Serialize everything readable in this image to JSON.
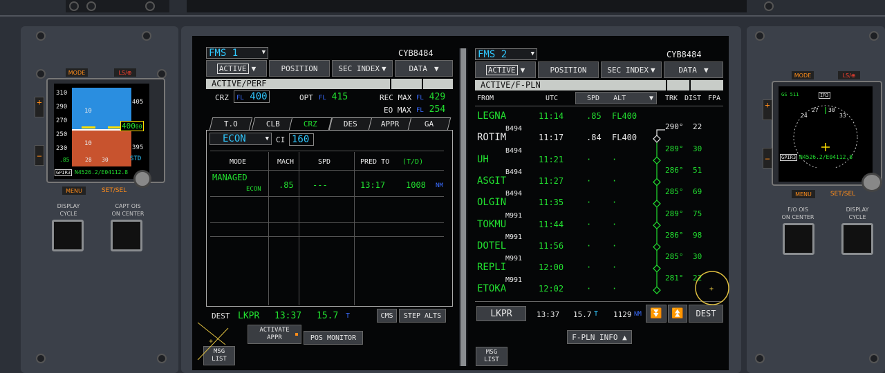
{
  "left_panel": {
    "mode_label": "MODE",
    "ls_label": "LS/⊕",
    "menu_label": "MENU",
    "setsel_label": "SET/SEL",
    "display_cycle_label": "DISPLAY\nCYCLE",
    "capt_ois_label": "CAPT OIS\nON CENTER",
    "speed_ticks": [
      "310",
      "290",
      "270",
      "250",
      "230"
    ],
    "alt_ticks": [
      "405",
      "400",
      "395"
    ],
    "alt_readout": "400",
    "alt_sub": "00",
    "mach": ".85",
    "std": "STD",
    "gpirs": "GPIR3",
    "pos": "N4526.2/E04112.8",
    "pitch_top": "10",
    "pitch_bot": "10",
    "roll_marks": [
      "28",
      "30"
    ]
  },
  "right_panel": {
    "mode_label": "MODE",
    "ls_label": "LS/⊕",
    "menu_label": "MENU",
    "setsel_label": "SET/SEL",
    "fo_ois_label": "F/O OIS\nON CENTER",
    "display_cycle_label": "DISPLAY\nCYCLE",
    "gs": "GS 511",
    "ir": "IR3",
    "gpirs": "GPIR3",
    "pos": "N4526.2/E04112.8",
    "heading_marks": [
      "24",
      "27",
      "30",
      "33"
    ]
  },
  "fms1": {
    "title": "FMS 1",
    "flight_id": "CYB8484",
    "nav": [
      "ACTIVE",
      "POSITION",
      "SEC INDEX",
      "DATA"
    ],
    "page_title": "ACTIVE/PERF",
    "crz_label": "CRZ",
    "crz_fl": "FL",
    "crz_val": "400",
    "opt_label": "OPT",
    "opt_fl": "FL",
    "opt_val": "415",
    "recmax_label": "REC MAX",
    "recmax_fl": "FL",
    "recmax_val": "429",
    "eomax_label": "EO MAX",
    "eomax_fl": "FL",
    "eomax_val": "254",
    "tabs": [
      "T.O",
      "CLB",
      "CRZ",
      "DES",
      "APPR",
      "GA"
    ],
    "mode_select": "ECON",
    "ci_label": "CI",
    "ci_val": "160",
    "cols": [
      "MODE",
      "MACH",
      "SPD",
      "PRED TO",
      "(T/D)"
    ],
    "row_mode": "MANAGED",
    "row_mode_sub": "ECON",
    "row_mach": ".85",
    "row_spd": "---",
    "row_time": "13:17",
    "row_dist": "1008",
    "row_unit": "NM",
    "dest_label": "DEST",
    "dest_apt": "LKPR",
    "dest_time": "13:37",
    "dest_fuel": "15.7",
    "dest_unit": "T",
    "cms_btn": "CMS",
    "step_btn": "STEP ALTS",
    "activate_btn": "ACTIVATE\nAPPR",
    "posmon_btn": "POS MONITOR",
    "msg_btn": "MSG\nLIST"
  },
  "fms2": {
    "title": "FMS 2",
    "flight_id": "CYB8484",
    "nav": [
      "ACTIVE",
      "POSITION",
      "SEC INDEX",
      "DATA"
    ],
    "page_title": "ACTIVE/F-PLN",
    "headers": [
      "FROM",
      "UTC",
      "SPD",
      "ALT",
      "TRK",
      "DIST",
      "FPA"
    ],
    "rows": [
      {
        "awy": "",
        "wpt": "LEGNA",
        "utc": "11:14",
        "spd": ".85",
        "alt": "FL400",
        "trk": "",
        "dist": "",
        "wpt_white": false
      },
      {
        "awy": "B494",
        "wpt": "ROTIM",
        "utc": "11:17",
        "spd": ".84",
        "alt": "FL400",
        "trk": "290°",
        "dist": "22",
        "wpt_white": true
      },
      {
        "awy": "B494",
        "wpt": "UH",
        "utc": "11:21",
        "spd": "·",
        "alt": "·",
        "trk": "289°",
        "dist": "30",
        "wpt_white": false
      },
      {
        "awy": "B494",
        "wpt": "ASGIT",
        "utc": "11:27",
        "spd": "·",
        "alt": "·",
        "trk": "286°",
        "dist": "51",
        "wpt_white": false
      },
      {
        "awy": "B494",
        "wpt": "OLGIN",
        "utc": "11:35",
        "spd": "·",
        "alt": "·",
        "trk": "285°",
        "dist": "69",
        "wpt_white": false
      },
      {
        "awy": "M991",
        "wpt": "TOKMU",
        "utc": "11:44",
        "spd": "·",
        "alt": "·",
        "trk": "289°",
        "dist": "75",
        "wpt_white": false
      },
      {
        "awy": "M991",
        "wpt": "DOTEL",
        "utc": "11:56",
        "spd": "·",
        "alt": "·",
        "trk": "286°",
        "dist": "98",
        "wpt_white": false
      },
      {
        "awy": "M991",
        "wpt": "REPLI",
        "utc": "12:00",
        "spd": "·",
        "alt": "·",
        "trk": "285°",
        "dist": "30",
        "wpt_white": false
      },
      {
        "awy": "M991",
        "wpt": "ETOKA",
        "utc": "12:02",
        "spd": "·",
        "alt": "·",
        "trk": "281°",
        "dist": "22",
        "wpt_white": false
      }
    ],
    "dest_btn_apt": "LKPR",
    "dest_time": "13:37",
    "dest_fuel": "15.7",
    "dest_unit": "T",
    "dest_dist": "1129",
    "dest_nm": "NM",
    "dest_btn": "DEST",
    "fpln_info_btn": "F-PLN INFO ▲",
    "msg_btn": "MSG\nLIST"
  },
  "colors": {
    "green": "#22e030",
    "cyan": "#30c8ff",
    "amber": "#ff8c1a",
    "white": "#e8e8e8"
  }
}
